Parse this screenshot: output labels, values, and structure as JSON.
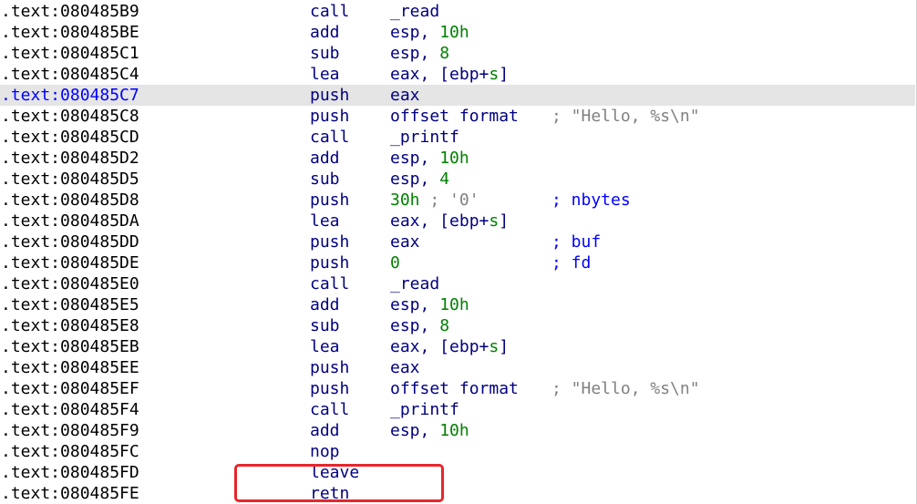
{
  "colors": {
    "address": "#000000",
    "selected_address": "#0000ff",
    "selected_background": "#e5e5e5",
    "code": "#000080",
    "number": "#008000",
    "comment": "#808080",
    "xref_comment": "#0000ff"
  },
  "annotation": {
    "shape": "rounded-rectangle",
    "color": "#e8262b"
  },
  "listing": {
    "rows": [
      {
        "address": ".text:080485B9",
        "mnemonic": "call",
        "operand": [
          {
            "text": "_read",
            "color": "#000080"
          }
        ],
        "comment": []
      },
      {
        "address": ".text:080485BE",
        "mnemonic": "add",
        "operand": [
          {
            "text": "esp, ",
            "color": "#000080"
          },
          {
            "text": "10h",
            "color": "#008000"
          }
        ],
        "comment": []
      },
      {
        "address": ".text:080485C1",
        "mnemonic": "sub",
        "operand": [
          {
            "text": "esp, ",
            "color": "#000080"
          },
          {
            "text": "8",
            "color": "#008000"
          }
        ],
        "comment": []
      },
      {
        "address": ".text:080485C4",
        "mnemonic": "lea",
        "operand": [
          {
            "text": "eax, [ebp+",
            "color": "#000080"
          },
          {
            "text": "s",
            "color": "#008000"
          },
          {
            "text": "]",
            "color": "#000080"
          }
        ],
        "comment": []
      },
      {
        "address": ".text:080485C7",
        "mnemonic": "push",
        "operand": [
          {
            "text": "eax",
            "color": "#000080"
          }
        ],
        "comment": [],
        "selected": true
      },
      {
        "address": ".text:080485C8",
        "mnemonic": "push",
        "operand": [
          {
            "text": "offset format",
            "color": "#000080"
          }
        ],
        "comment": [
          {
            "text": "; \"Hello, %s\\n\"",
            "color": "#808080"
          }
        ]
      },
      {
        "address": ".text:080485CD",
        "mnemonic": "call",
        "operand": [
          {
            "text": "_printf",
            "color": "#000080"
          }
        ],
        "comment": []
      },
      {
        "address": ".text:080485D2",
        "mnemonic": "add",
        "operand": [
          {
            "text": "esp, ",
            "color": "#000080"
          },
          {
            "text": "10h",
            "color": "#008000"
          }
        ],
        "comment": []
      },
      {
        "address": ".text:080485D5",
        "mnemonic": "sub",
        "operand": [
          {
            "text": "esp, ",
            "color": "#000080"
          },
          {
            "text": "4",
            "color": "#008000"
          }
        ],
        "comment": []
      },
      {
        "address": ".text:080485D8",
        "mnemonic": "push",
        "operand": [
          {
            "text": "30h",
            "color": "#008000"
          },
          {
            "text": " ; '0'",
            "color": "#808080"
          }
        ],
        "comment": [
          {
            "text": "; nbytes",
            "color": "#0000ff"
          }
        ]
      },
      {
        "address": ".text:080485DA",
        "mnemonic": "lea",
        "operand": [
          {
            "text": "eax, [ebp+",
            "color": "#000080"
          },
          {
            "text": "s",
            "color": "#008000"
          },
          {
            "text": "]",
            "color": "#000080"
          }
        ],
        "comment": []
      },
      {
        "address": ".text:080485DD",
        "mnemonic": "push",
        "operand": [
          {
            "text": "eax",
            "color": "#000080"
          }
        ],
        "comment": [
          {
            "text": "; buf",
            "color": "#0000ff"
          }
        ]
      },
      {
        "address": ".text:080485DE",
        "mnemonic": "push",
        "operand": [
          {
            "text": "0",
            "color": "#008000"
          }
        ],
        "comment": [
          {
            "text": "; fd",
            "color": "#0000ff"
          }
        ]
      },
      {
        "address": ".text:080485E0",
        "mnemonic": "call",
        "operand": [
          {
            "text": "_read",
            "color": "#000080"
          }
        ],
        "comment": []
      },
      {
        "address": ".text:080485E5",
        "mnemonic": "add",
        "operand": [
          {
            "text": "esp, ",
            "color": "#000080"
          },
          {
            "text": "10h",
            "color": "#008000"
          }
        ],
        "comment": []
      },
      {
        "address": ".text:080485E8",
        "mnemonic": "sub",
        "operand": [
          {
            "text": "esp, ",
            "color": "#000080"
          },
          {
            "text": "8",
            "color": "#008000"
          }
        ],
        "comment": []
      },
      {
        "address": ".text:080485EB",
        "mnemonic": "lea",
        "operand": [
          {
            "text": "eax, [ebp+",
            "color": "#000080"
          },
          {
            "text": "s",
            "color": "#008000"
          },
          {
            "text": "]",
            "color": "#000080"
          }
        ],
        "comment": []
      },
      {
        "address": ".text:080485EE",
        "mnemonic": "push",
        "operand": [
          {
            "text": "eax",
            "color": "#000080"
          }
        ],
        "comment": []
      },
      {
        "address": ".text:080485EF",
        "mnemonic": "push",
        "operand": [
          {
            "text": "offset format",
            "color": "#000080"
          }
        ],
        "comment": [
          {
            "text": "; \"Hello, %s\\n\"",
            "color": "#808080"
          }
        ]
      },
      {
        "address": ".text:080485F4",
        "mnemonic": "call",
        "operand": [
          {
            "text": "_printf",
            "color": "#000080"
          }
        ],
        "comment": []
      },
      {
        "address": ".text:080485F9",
        "mnemonic": "add",
        "operand": [
          {
            "text": "esp, ",
            "color": "#000080"
          },
          {
            "text": "10h",
            "color": "#008000"
          }
        ],
        "comment": []
      },
      {
        "address": ".text:080485FC",
        "mnemonic": "nop",
        "operand": [],
        "comment": []
      },
      {
        "address": ".text:080485FD",
        "mnemonic": "leave",
        "operand": [],
        "comment": [],
        "boxed": true
      },
      {
        "address": ".text:080485FE",
        "mnemonic": "retn",
        "operand": [],
        "comment": [],
        "boxed": true
      }
    ]
  }
}
